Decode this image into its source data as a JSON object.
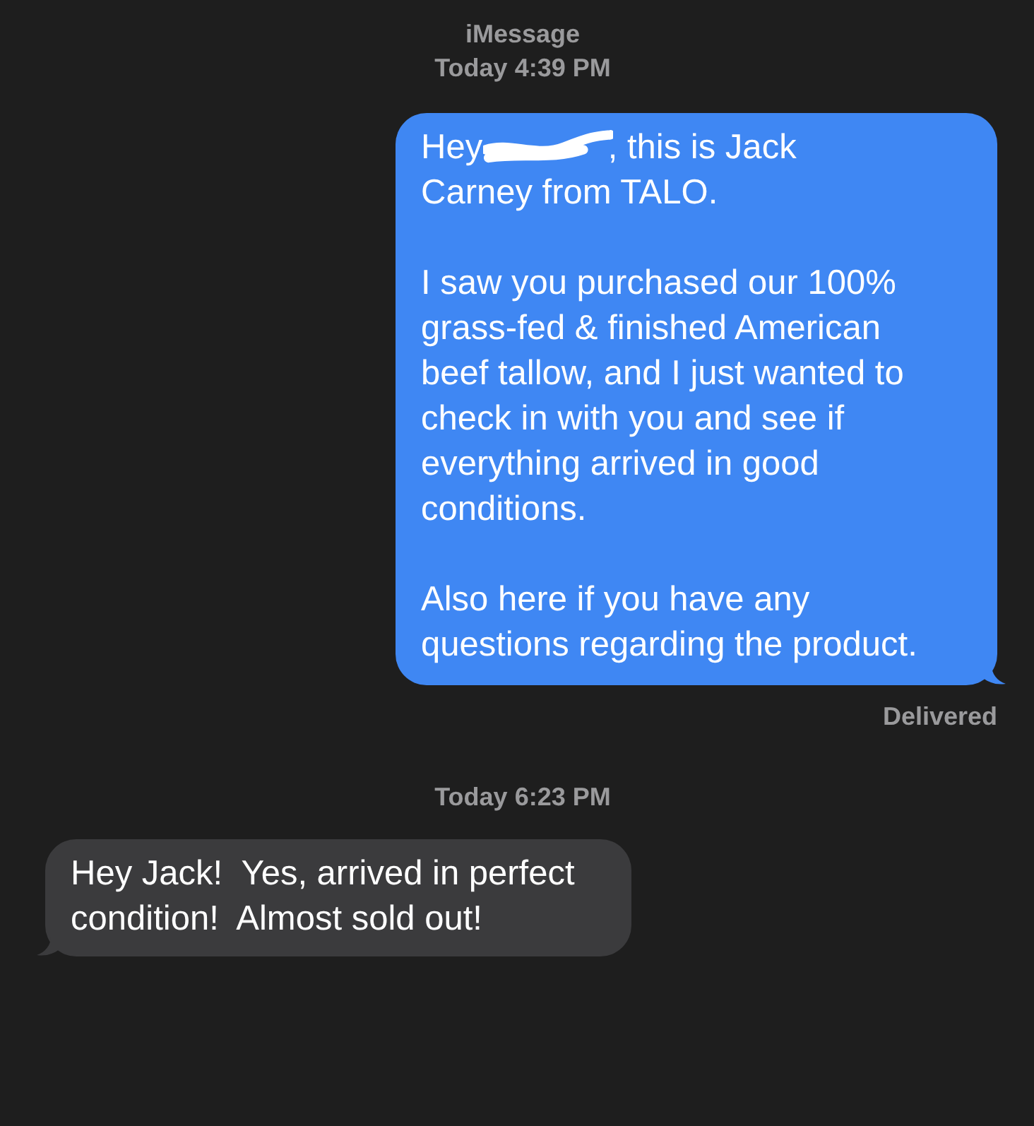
{
  "header": {
    "service": "iMessage",
    "time": "Today 4:39 PM"
  },
  "items": [
    {
      "kind": "sent",
      "paragraphs": [
        [
          {
            "kind": "text",
            "text": "Hey "
          },
          {
            "kind": "redaction"
          },
          {
            "kind": "text",
            "text": ", this is Jack "
          },
          {
            "kind": "text",
            "text": "Carney from TALO."
          }
        ],
        [
          {
            "kind": "text",
            "text": "I saw you purchased our 100% grass-fed & finished American beef tallow, and I just wanted to check in with you and see if everything arrived in good conditions."
          }
        ],
        [
          {
            "kind": "text",
            "text": "Also here if you have any questions regarding the product."
          }
        ]
      ],
      "status": "Delivered"
    },
    {
      "kind": "time",
      "text": "Today 6:23 PM"
    },
    {
      "kind": "received",
      "paragraphs": [
        [
          {
            "kind": "text",
            "text": "Hey Jack!  Yes, arrived in perfect condition!  Almost sold out!"
          }
        ]
      ]
    }
  ]
}
